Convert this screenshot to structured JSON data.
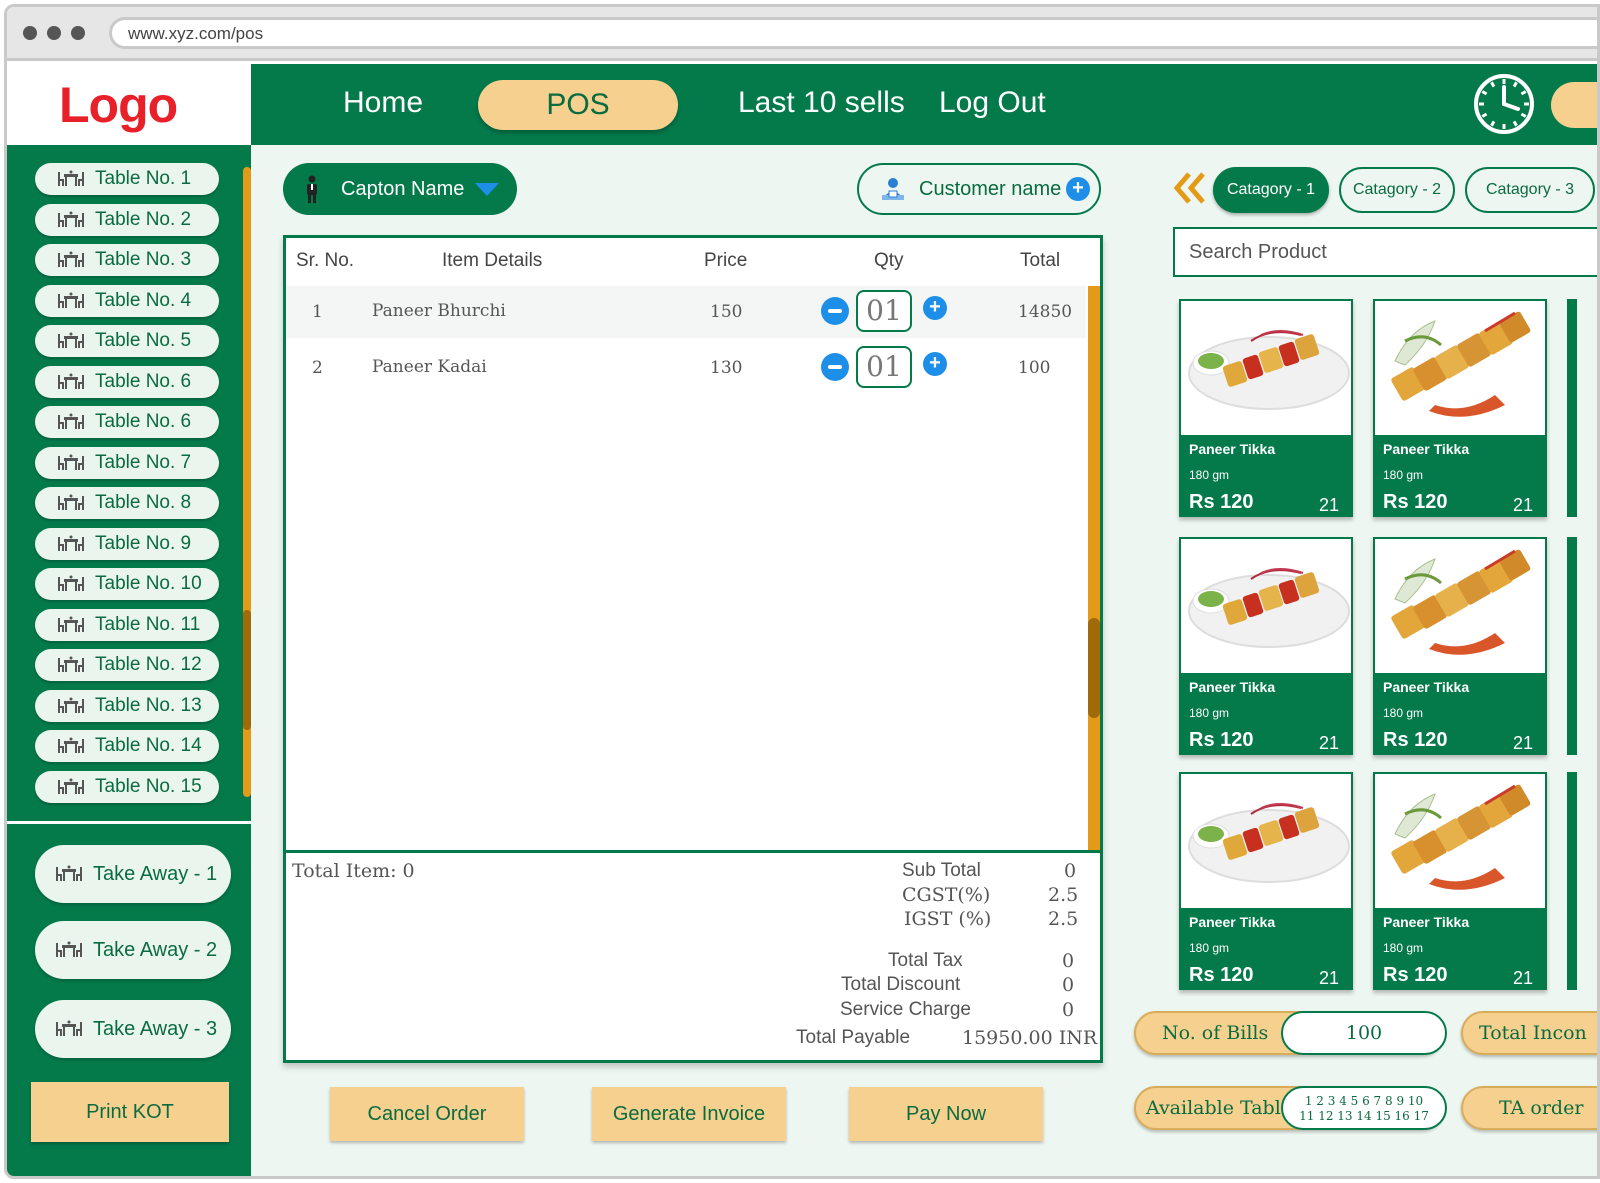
{
  "browser": {
    "url": "www.xyz.com/pos"
  },
  "logo": "Logo",
  "nav": {
    "items": [
      {
        "label": "Home"
      },
      {
        "label": "POS"
      },
      {
        "label": "Last 10 sells"
      },
      {
        "label": "Log Out"
      }
    ],
    "active": "POS"
  },
  "sidebar": {
    "tables": [
      "Table No. 1",
      "Table No. 2",
      "Table No. 3",
      "Table No. 4",
      "Table No. 5",
      "Table No. 6",
      "Table No. 6",
      "Table No. 7",
      "Table No. 8",
      "Table No. 9",
      "Table No. 10",
      "Table No. 11",
      "Table No. 12",
      "Table No. 13",
      "Table No. 14",
      "Table No. 15"
    ],
    "takeaways": [
      "Take Away - 1",
      "Take Away - 2",
      "Take Away - 3"
    ],
    "print_kot": "Print KOT"
  },
  "order": {
    "captain_select": "Capton Name",
    "customer_button": "Customer name",
    "columns": [
      "Sr. No.",
      "Item Details",
      "Price",
      "Qty",
      "Total"
    ],
    "rows": [
      {
        "sr": "1",
        "item": "Paneer Bhurchi",
        "price": "150",
        "qty": "01",
        "total": "14850"
      },
      {
        "sr": "2",
        "item": "Paneer Kadai",
        "price": "130",
        "qty": "01",
        "total": "100"
      }
    ],
    "total_items": "Total Item: 0",
    "summary": {
      "sub_total_label": "Sub Total",
      "sub_total": "0",
      "cgst_label": "CGST(%)",
      "cgst": "2.5",
      "igst_label": "IGST (%)",
      "igst": "2.5",
      "total_tax_label": "Total Tax",
      "total_tax": "0",
      "total_discount_label": "Total Discount",
      "total_discount": "0",
      "service_charge_label": "Service Charge",
      "service_charge": "0",
      "total_payable_label": "Total Payable",
      "total_payable": "15950.00 INR"
    },
    "actions": [
      "Cancel Order",
      "Generate Invoice",
      "Pay Now"
    ]
  },
  "products": {
    "categories": [
      "Catagory - 1",
      "Catagory - 2",
      "Catagory - 3"
    ],
    "active_category": "Catagory - 1",
    "search_placeholder": "Search Product",
    "items": [
      {
        "name": "Paneer Tikka",
        "weight": "180 gm",
        "price": "Rs 120",
        "qty": "21",
        "image": "plated-tikka"
      },
      {
        "name": "Paneer Tikka",
        "weight": "180 gm",
        "price": "Rs 120",
        "qty": "21",
        "image": "skewer-tikka"
      },
      {
        "name": "Paneer Tikka",
        "weight": "180 gm",
        "price": "Rs 120",
        "qty": "21",
        "image": "plated-tikka"
      },
      {
        "name": "Paneer Tikka",
        "weight": "180 gm",
        "price": "Rs 120",
        "qty": "21",
        "image": "skewer-tikka"
      },
      {
        "name": "Paneer Tikka",
        "weight": "180 gm",
        "price": "Rs 120",
        "qty": "21",
        "image": "plated-tikka"
      },
      {
        "name": "Paneer Tikka",
        "weight": "180 gm",
        "price": "Rs 120",
        "qty": "21",
        "image": "skewer-tikka"
      }
    ]
  },
  "stats": {
    "bills_label": "No. of Bills",
    "bills_value": "100",
    "income_label": "Total Incon",
    "available_table_label": "Available Table",
    "available_tables_line1": "1 2 3 4 5 6 7 8 9 10",
    "available_tables_line2": "11 12 13 14 15 16 17",
    "ta_order_label": "TA order"
  },
  "colors": {
    "primary": "#047a4b",
    "accent": "#f5d08f",
    "logo": "#e8202a",
    "scroll": "#e39a17",
    "action_blue": "#1e8fe8"
  }
}
